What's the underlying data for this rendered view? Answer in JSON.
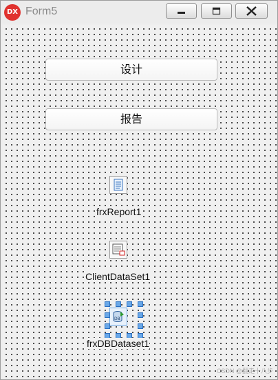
{
  "window": {
    "app_icon": "DX",
    "title": "Form5",
    "controls": [
      "minimize-icon",
      "maximize-icon",
      "close-icon"
    ]
  },
  "form": {
    "buttons": [
      {
        "label": "设计"
      },
      {
        "label": "报告"
      }
    ],
    "components": [
      {
        "label": "frxReport1",
        "icon": "report-icon"
      },
      {
        "label": "ClientDataSet1",
        "icon": "dataset-icon"
      },
      {
        "label": "frxDBDataset1",
        "icon": "db-dataset-icon",
        "selected": true
      }
    ]
  },
  "watermark": "CSDN @翻走十八步",
  "colors": {
    "selection_handle": "#6aa8e8",
    "app_icon_bg": "#e0322e"
  }
}
